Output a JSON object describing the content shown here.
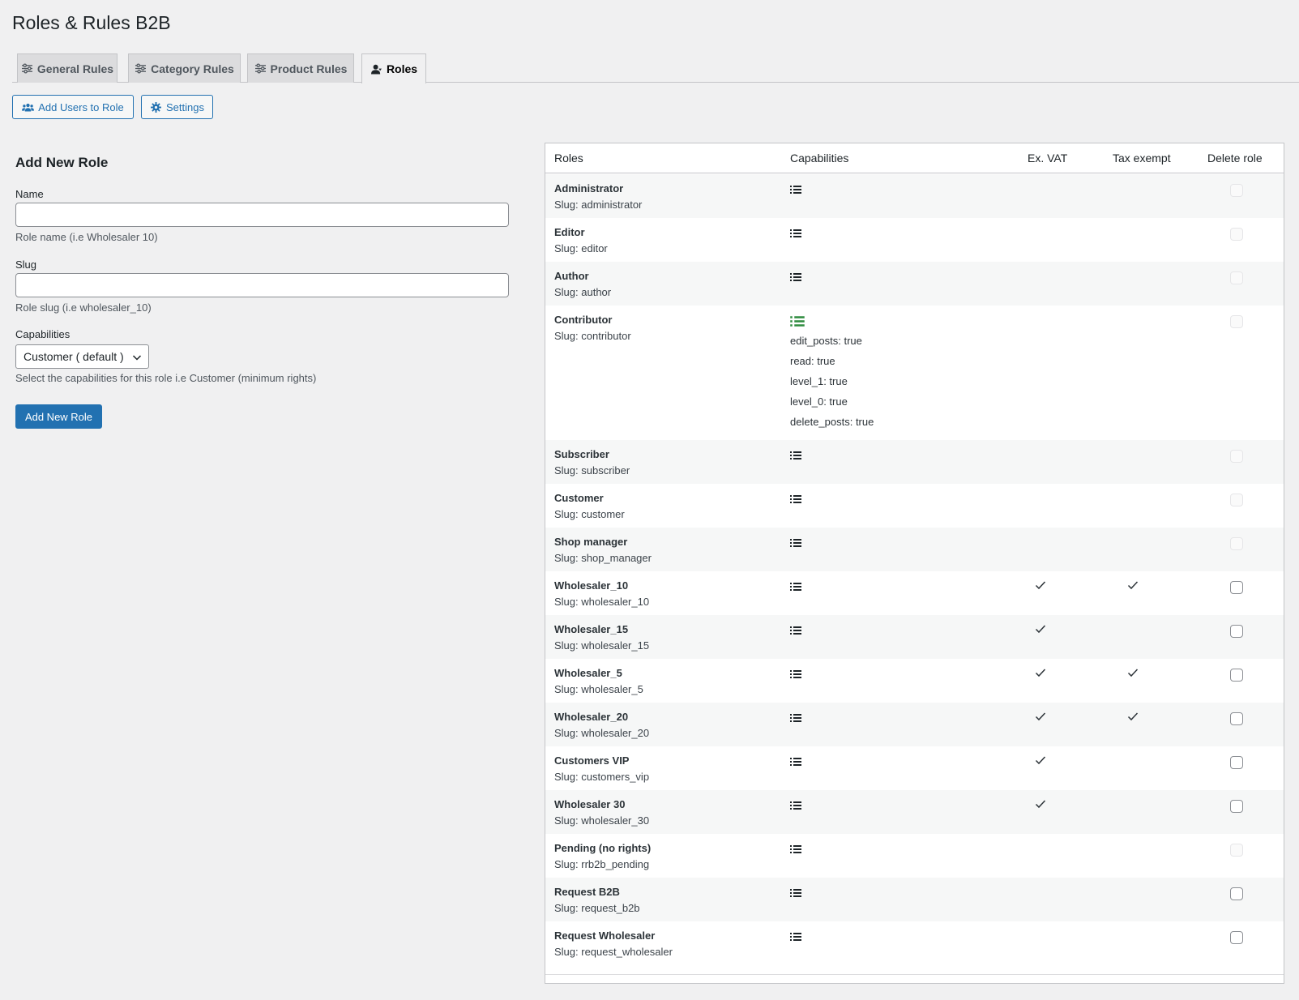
{
  "page": {
    "title": "Roles & Rules B2B"
  },
  "tabs": [
    {
      "label": "General Rules",
      "icon": "sliders-icon"
    },
    {
      "label": "Category Rules",
      "icon": "sliders-icon"
    },
    {
      "label": "Product Rules",
      "icon": "sliders-icon"
    },
    {
      "label": "Roles",
      "icon": "user-icon",
      "active": true
    }
  ],
  "actions": {
    "add_users_label": "Add Users to Role",
    "settings_label": "Settings"
  },
  "form": {
    "heading": "Add New Role",
    "name_label": "Name",
    "name_value": "",
    "name_desc": "Role name (i.e Wholesaler 10)",
    "slug_label": "Slug",
    "slug_value": "",
    "slug_desc": "Role slug (i.e wholesaler_10)",
    "capabilities_label": "Capabilities",
    "capabilities_selected": "Customer ( default )",
    "capabilities_desc": "Select the capabilities for this role i.e Customer (minimum rights)",
    "submit_label": "Add New Role"
  },
  "table": {
    "columns": [
      "Roles",
      "Capabilities",
      "Ex. VAT",
      "Tax exempt",
      "Delete role"
    ],
    "rows": [
      {
        "name": "Administrator",
        "slug": "Slug: administrator",
        "ex_vat": false,
        "tax_exempt": false,
        "deletable": false
      },
      {
        "name": "Editor",
        "slug": "Slug: editor",
        "ex_vat": false,
        "tax_exempt": false,
        "deletable": false
      },
      {
        "name": "Author",
        "slug": "Slug: author",
        "ex_vat": false,
        "tax_exempt": false,
        "deletable": false
      },
      {
        "name": "Contributor",
        "slug": "Slug: contributor",
        "ex_vat": false,
        "tax_exempt": false,
        "deletable": false,
        "expanded": true,
        "capabilities": [
          "edit_posts: true",
          "read: true",
          "level_1: true",
          "level_0: true",
          "delete_posts: true"
        ]
      },
      {
        "name": "Subscriber",
        "slug": "Slug: subscriber",
        "ex_vat": false,
        "tax_exempt": false,
        "deletable": false
      },
      {
        "name": "Customer",
        "slug": "Slug: customer",
        "ex_vat": false,
        "tax_exempt": false,
        "deletable": false
      },
      {
        "name": "Shop manager",
        "slug": "Slug: shop_manager",
        "ex_vat": false,
        "tax_exempt": false,
        "deletable": false
      },
      {
        "name": "Wholesaler_10",
        "slug": "Slug: wholesaler_10",
        "ex_vat": true,
        "tax_exempt": true,
        "deletable": true
      },
      {
        "name": "Wholesaler_15",
        "slug": "Slug: wholesaler_15",
        "ex_vat": true,
        "tax_exempt": false,
        "deletable": true
      },
      {
        "name": "Wholesaler_5",
        "slug": "Slug: wholesaler_5",
        "ex_vat": true,
        "tax_exempt": true,
        "deletable": true
      },
      {
        "name": "Wholesaler_20",
        "slug": "Slug: wholesaler_20",
        "ex_vat": true,
        "tax_exempt": true,
        "deletable": true
      },
      {
        "name": "Customers VIP",
        "slug": "Slug: customers_vip",
        "ex_vat": true,
        "tax_exempt": false,
        "deletable": true
      },
      {
        "name": "Wholesaler 30",
        "slug": "Slug: wholesaler_30",
        "ex_vat": true,
        "tax_exempt": false,
        "deletable": true
      },
      {
        "name": "Pending (no rights)",
        "slug": "Slug: rrb2b_pending",
        "ex_vat": false,
        "tax_exempt": false,
        "deletable": false
      },
      {
        "name": "Request B2B",
        "slug": "Slug: request_b2b",
        "ex_vat": false,
        "tax_exempt": false,
        "deletable": true
      },
      {
        "name": "Request Wholesaler",
        "slug": "Slug: request_wholesaler",
        "ex_vat": false,
        "tax_exempt": false,
        "deletable": true
      }
    ]
  },
  "colors": {
    "accent": "#2271b1",
    "expanded_icon": "#2e8b3e",
    "background": "#f0f0f1"
  }
}
